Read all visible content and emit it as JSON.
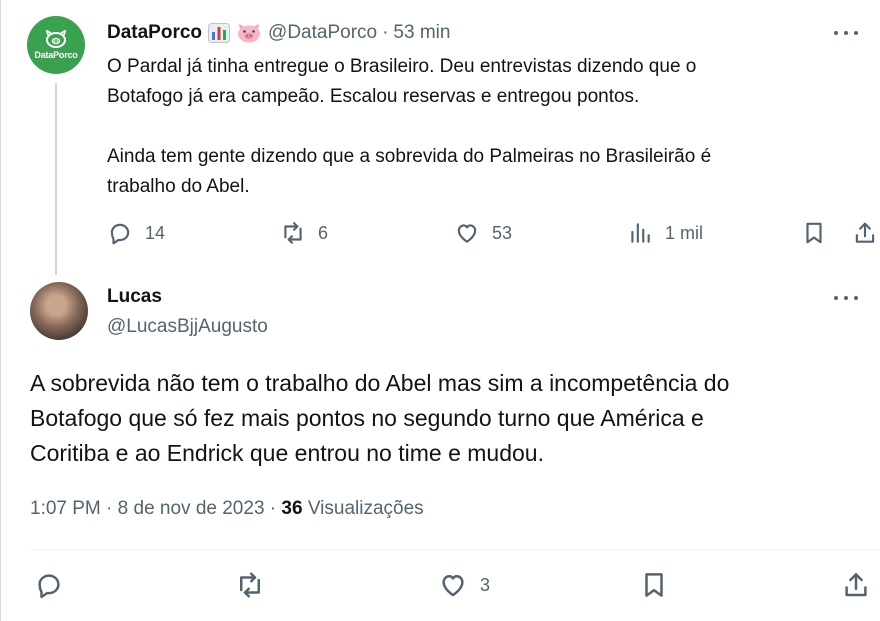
{
  "parent_tweet": {
    "author_name": "DataPorco",
    "avatar_label": "DataPorco",
    "emojis": [
      "bar-chart-icon",
      "pig-face-icon"
    ],
    "handle": "@DataPorco",
    "time": "53 min",
    "body": [
      "O Pardal já tinha entregue o Brasileiro. Deu entrevistas dizendo que o",
      "Botafogo já era campeão. Escalou reservas e entregou pontos.",
      "",
      "Ainda tem gente dizendo que a sobrevida do Palmeiras no Brasileirão é",
      "trabalho do Abel."
    ],
    "actions": {
      "replies": "14",
      "reposts": "6",
      "likes": "53",
      "views": "1 mil"
    }
  },
  "reply_tweet": {
    "author_name": "Lucas",
    "handle": "@LucasBjjAugusto",
    "body": [
      "A sobrevida não tem o trabalho do Abel mas sim a incompetência do",
      "Botafogo que só fez mais pontos no segundo turno que América e",
      "Coritiba e ao Endrick que entrou no time e mudou."
    ],
    "meta": {
      "time": "1:07 PM",
      "date": "8 de nov de 2023",
      "views_count": "36",
      "views_label": "Visualizações"
    },
    "actions": {
      "likes": "3"
    }
  },
  "colors": {
    "text_primary": "#0f1419",
    "text_secondary": "#536471",
    "avatar_green": "#3aa14f",
    "thread_line": "#cfd9de"
  }
}
